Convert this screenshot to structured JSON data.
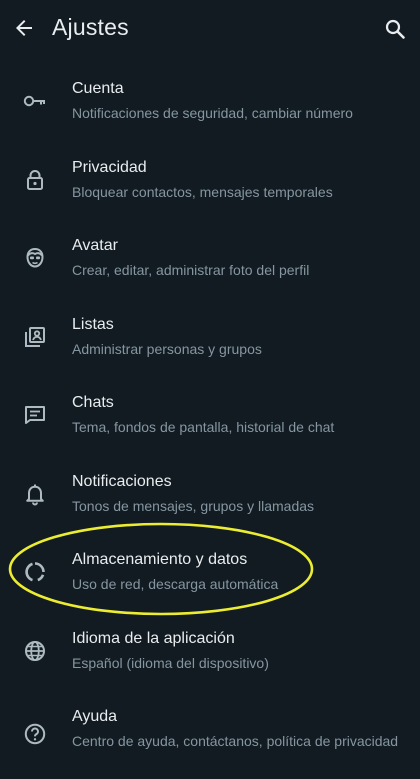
{
  "header": {
    "title": "Ajustes",
    "back_icon": "arrow-left-icon",
    "search_icon": "search-icon"
  },
  "colors": {
    "background": "#111b21",
    "text_primary": "#e9edef",
    "text_secondary": "#8696a0",
    "icon": "#aebac1",
    "highlight": "#ecec32"
  },
  "settings": {
    "items": [
      {
        "icon": "key-icon",
        "label": "Cuenta",
        "subtitle": "Notificaciones de seguridad, cambiar número"
      },
      {
        "icon": "lock-icon",
        "label": "Privacidad",
        "subtitle": "Bloquear contactos, mensajes temporales"
      },
      {
        "icon": "avatar-icon",
        "label": "Avatar",
        "subtitle": "Crear, editar, administrar foto del perfil"
      },
      {
        "icon": "contact-list-icon",
        "label": "Listas",
        "subtitle": "Administrar personas y grupos"
      },
      {
        "icon": "chat-icon",
        "label": "Chats",
        "subtitle": "Tema, fondos de pantalla, historial de chat"
      },
      {
        "icon": "bell-icon",
        "label": "Notificaciones",
        "subtitle": "Tonos de mensajes, grupos y llamadas"
      },
      {
        "icon": "storage-icon",
        "label": "Almacenamiento y datos",
        "subtitle": "Uso de red, descarga automática"
      },
      {
        "icon": "globe-icon",
        "label": "Idioma de la aplicación",
        "subtitle": "Español (idioma del dispositivo)"
      },
      {
        "icon": "help-icon",
        "label": "Ayuda",
        "subtitle": "Centro de ayuda, contáctanos, política de privacidad"
      }
    ]
  }
}
